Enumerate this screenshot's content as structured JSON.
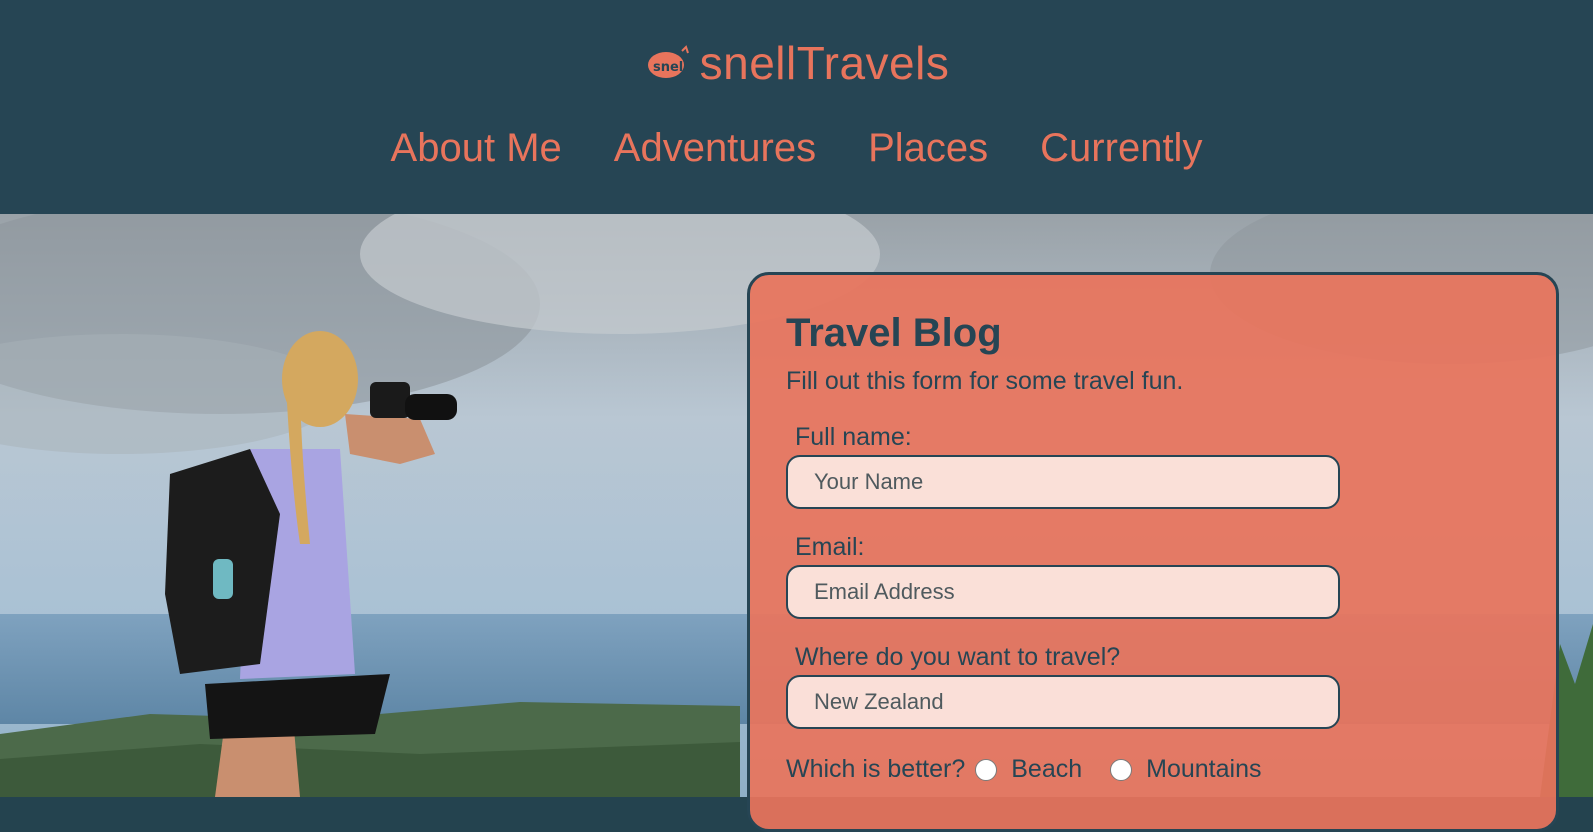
{
  "brand": {
    "name": "snellTravels",
    "logo_icon": "snell-logo-icon",
    "color": "#e8745c"
  },
  "nav": {
    "items": [
      {
        "label": "About Me"
      },
      {
        "label": "Adventures"
      },
      {
        "label": "Places"
      },
      {
        "label": "Currently"
      }
    ]
  },
  "colors": {
    "header_bg": "#264554",
    "accent": "#e8745c",
    "text_dark": "#264554"
  },
  "hero": {
    "description_icon": "photographer-photo"
  },
  "form": {
    "title": "Travel Blog",
    "subtitle": "Fill out this form for some travel fun.",
    "name_label": "Full name:",
    "name_placeholder": "Your Name",
    "email_label": "Email:",
    "email_placeholder": "Email Address",
    "destination_label": "Where do you want to travel?",
    "destination_placeholder": "New Zealand",
    "preference_label": "Which is better?",
    "options": [
      "Beach",
      "Mountains"
    ]
  }
}
